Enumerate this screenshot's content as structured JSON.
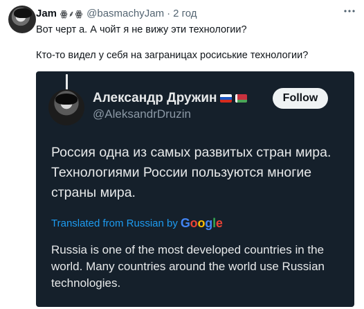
{
  "post": {
    "author_name": "Jam",
    "author_glyphs": "ꙮ⸙ꙮ",
    "handle": "@basmachyJam",
    "separator": "·",
    "timestamp": "2 год",
    "text_line_1": "Вот черт а. А чойт я не вижу эти технологии?",
    "text_line_2": "Кто-то видел у себя на заграницах росиськие технологии?",
    "more_icon": "more-horizontal-icon"
  },
  "embed": {
    "author_name": "Александр Дружин",
    "flags": [
      "russia-flag",
      "belarus-flag"
    ],
    "handle": "@AleksandrDruzin",
    "follow_label": "Follow",
    "body_lines": [
      "Россия одна из самых развитых стран мира.",
      "Технологиями России пользуются многие",
      "страны мира."
    ],
    "translated_label": "Translated from Russian by",
    "translation_provider": "Google",
    "translation_lines": [
      "Russia is one of the most developed countries in the",
      "world. Many countries around the world use Russian",
      "technologies."
    ],
    "colors": {
      "background": "#15202b",
      "text": "#e7e9ea",
      "muted": "#8b98a5",
      "link": "#1d9bf0"
    }
  }
}
